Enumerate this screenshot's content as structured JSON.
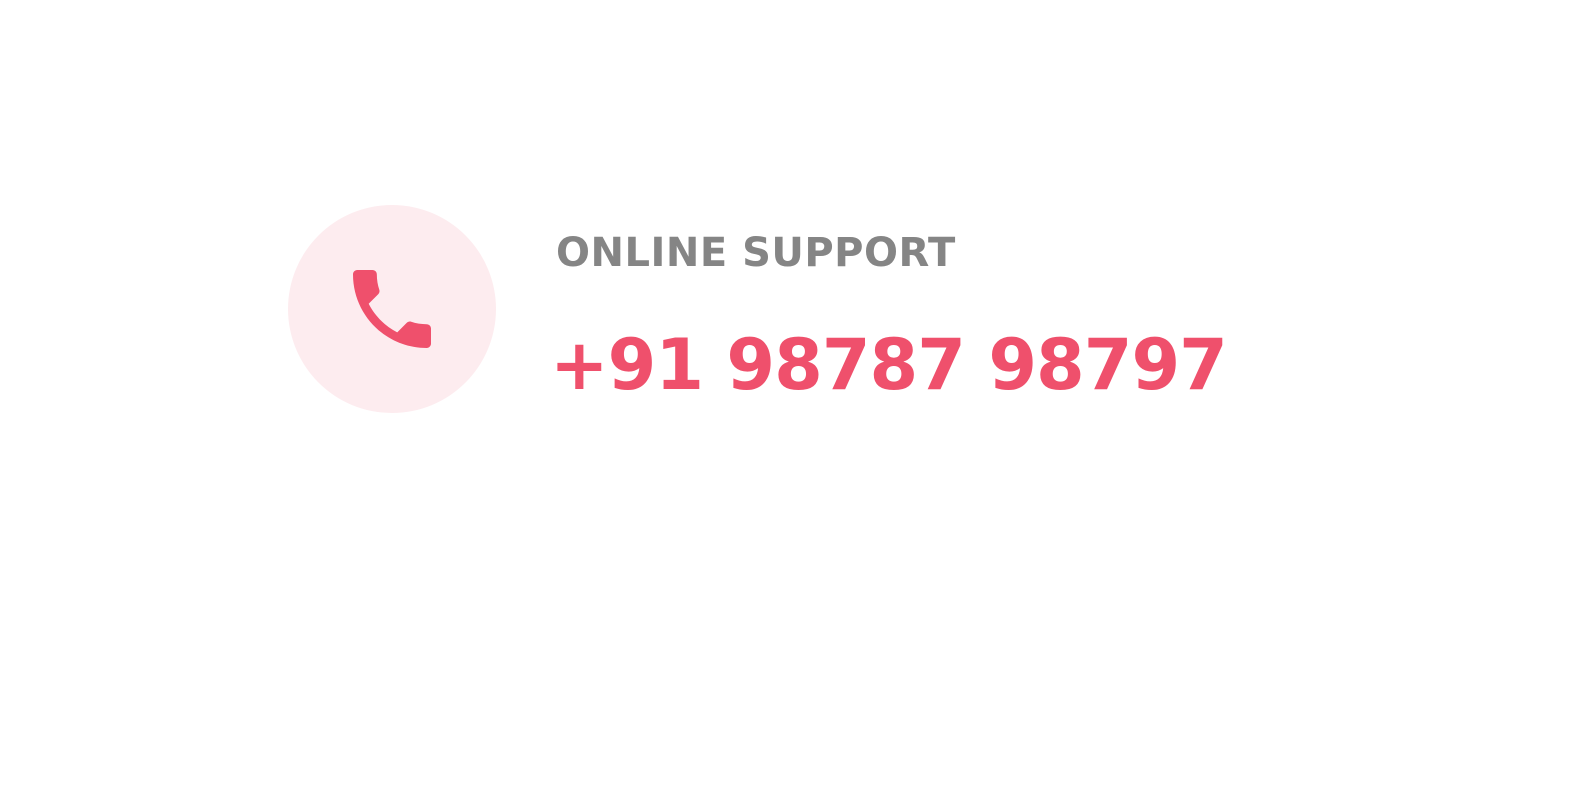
{
  "support": {
    "label": "ONLINE SUPPORT",
    "phone": "+91 98787 98797",
    "icon": "phone-icon"
  },
  "colors": {
    "accent": "#ef506c",
    "accent_soft": "#fdecef",
    "label": "#858585",
    "background": "#ffffff"
  }
}
